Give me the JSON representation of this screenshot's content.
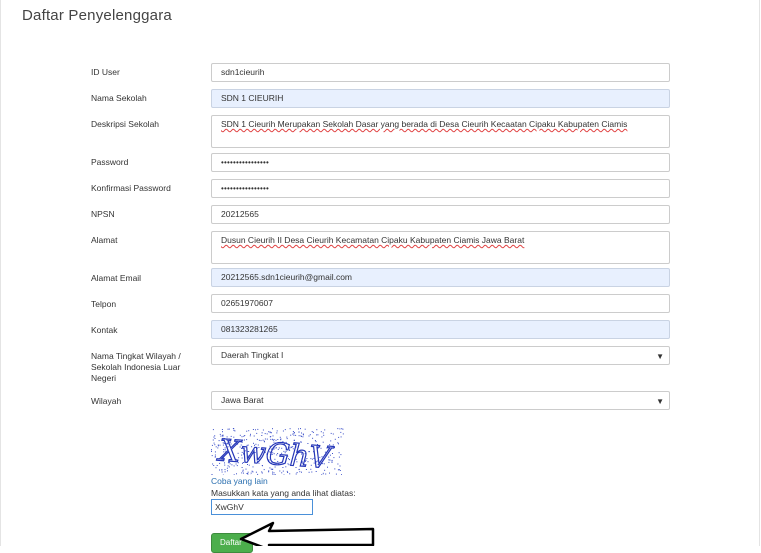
{
  "page": {
    "title": "Daftar Penyelenggara"
  },
  "form": {
    "id_user": {
      "label": "ID User",
      "value": "sdn1cieurih"
    },
    "nama_sekolah": {
      "label": "Nama Sekolah",
      "value": "SDN 1 CIEURIH"
    },
    "deskripsi": {
      "label": "Deskripsi Sekolah",
      "value": "SDN 1 Cieurih Merupakan Sekolah Dasar yang berada di Desa Cieurih Kecaatan Cipaku Kabupaten Ciamis"
    },
    "password": {
      "label": "Password",
      "value": "••••••••••••••••"
    },
    "konfirmasi": {
      "label": "Konfirmasi Password",
      "value": "••••••••••••••••"
    },
    "npsn": {
      "label": "NPSN",
      "value": "20212565"
    },
    "alamat": {
      "label": "Alamat",
      "value": "Dusun Cieurih II Desa Cieurih Kecamatan Cipaku Kabupaten Ciamis Jawa Barat"
    },
    "email": {
      "label": "Alamat Email",
      "value": "20212565.sdn1cieurih@gmail.com"
    },
    "telpon": {
      "label": "Telpon",
      "value": "02651970607"
    },
    "kontak": {
      "label": "Kontak",
      "value": "081323281265"
    },
    "tingkat": {
      "label": "Nama Tingkat Wilayah / Sekolah Indonesia Luar Negeri",
      "value": "Daerah Tingkat I"
    },
    "wilayah": {
      "label": "Wilayah",
      "value": "Jawa Barat"
    },
    "captcha": {
      "image_text": "XwGhV",
      "refresh_link": "Coba yang lain",
      "hint": "Masukkan kata yang anda lihat diatas:",
      "value": "XwGhV"
    },
    "submit_label": "Daftar"
  },
  "icons": {
    "select_caret": "▼"
  },
  "colors": {
    "highlight": "#e8f0fe",
    "button": "#4cae4c",
    "link": "#2a6fb0"
  }
}
